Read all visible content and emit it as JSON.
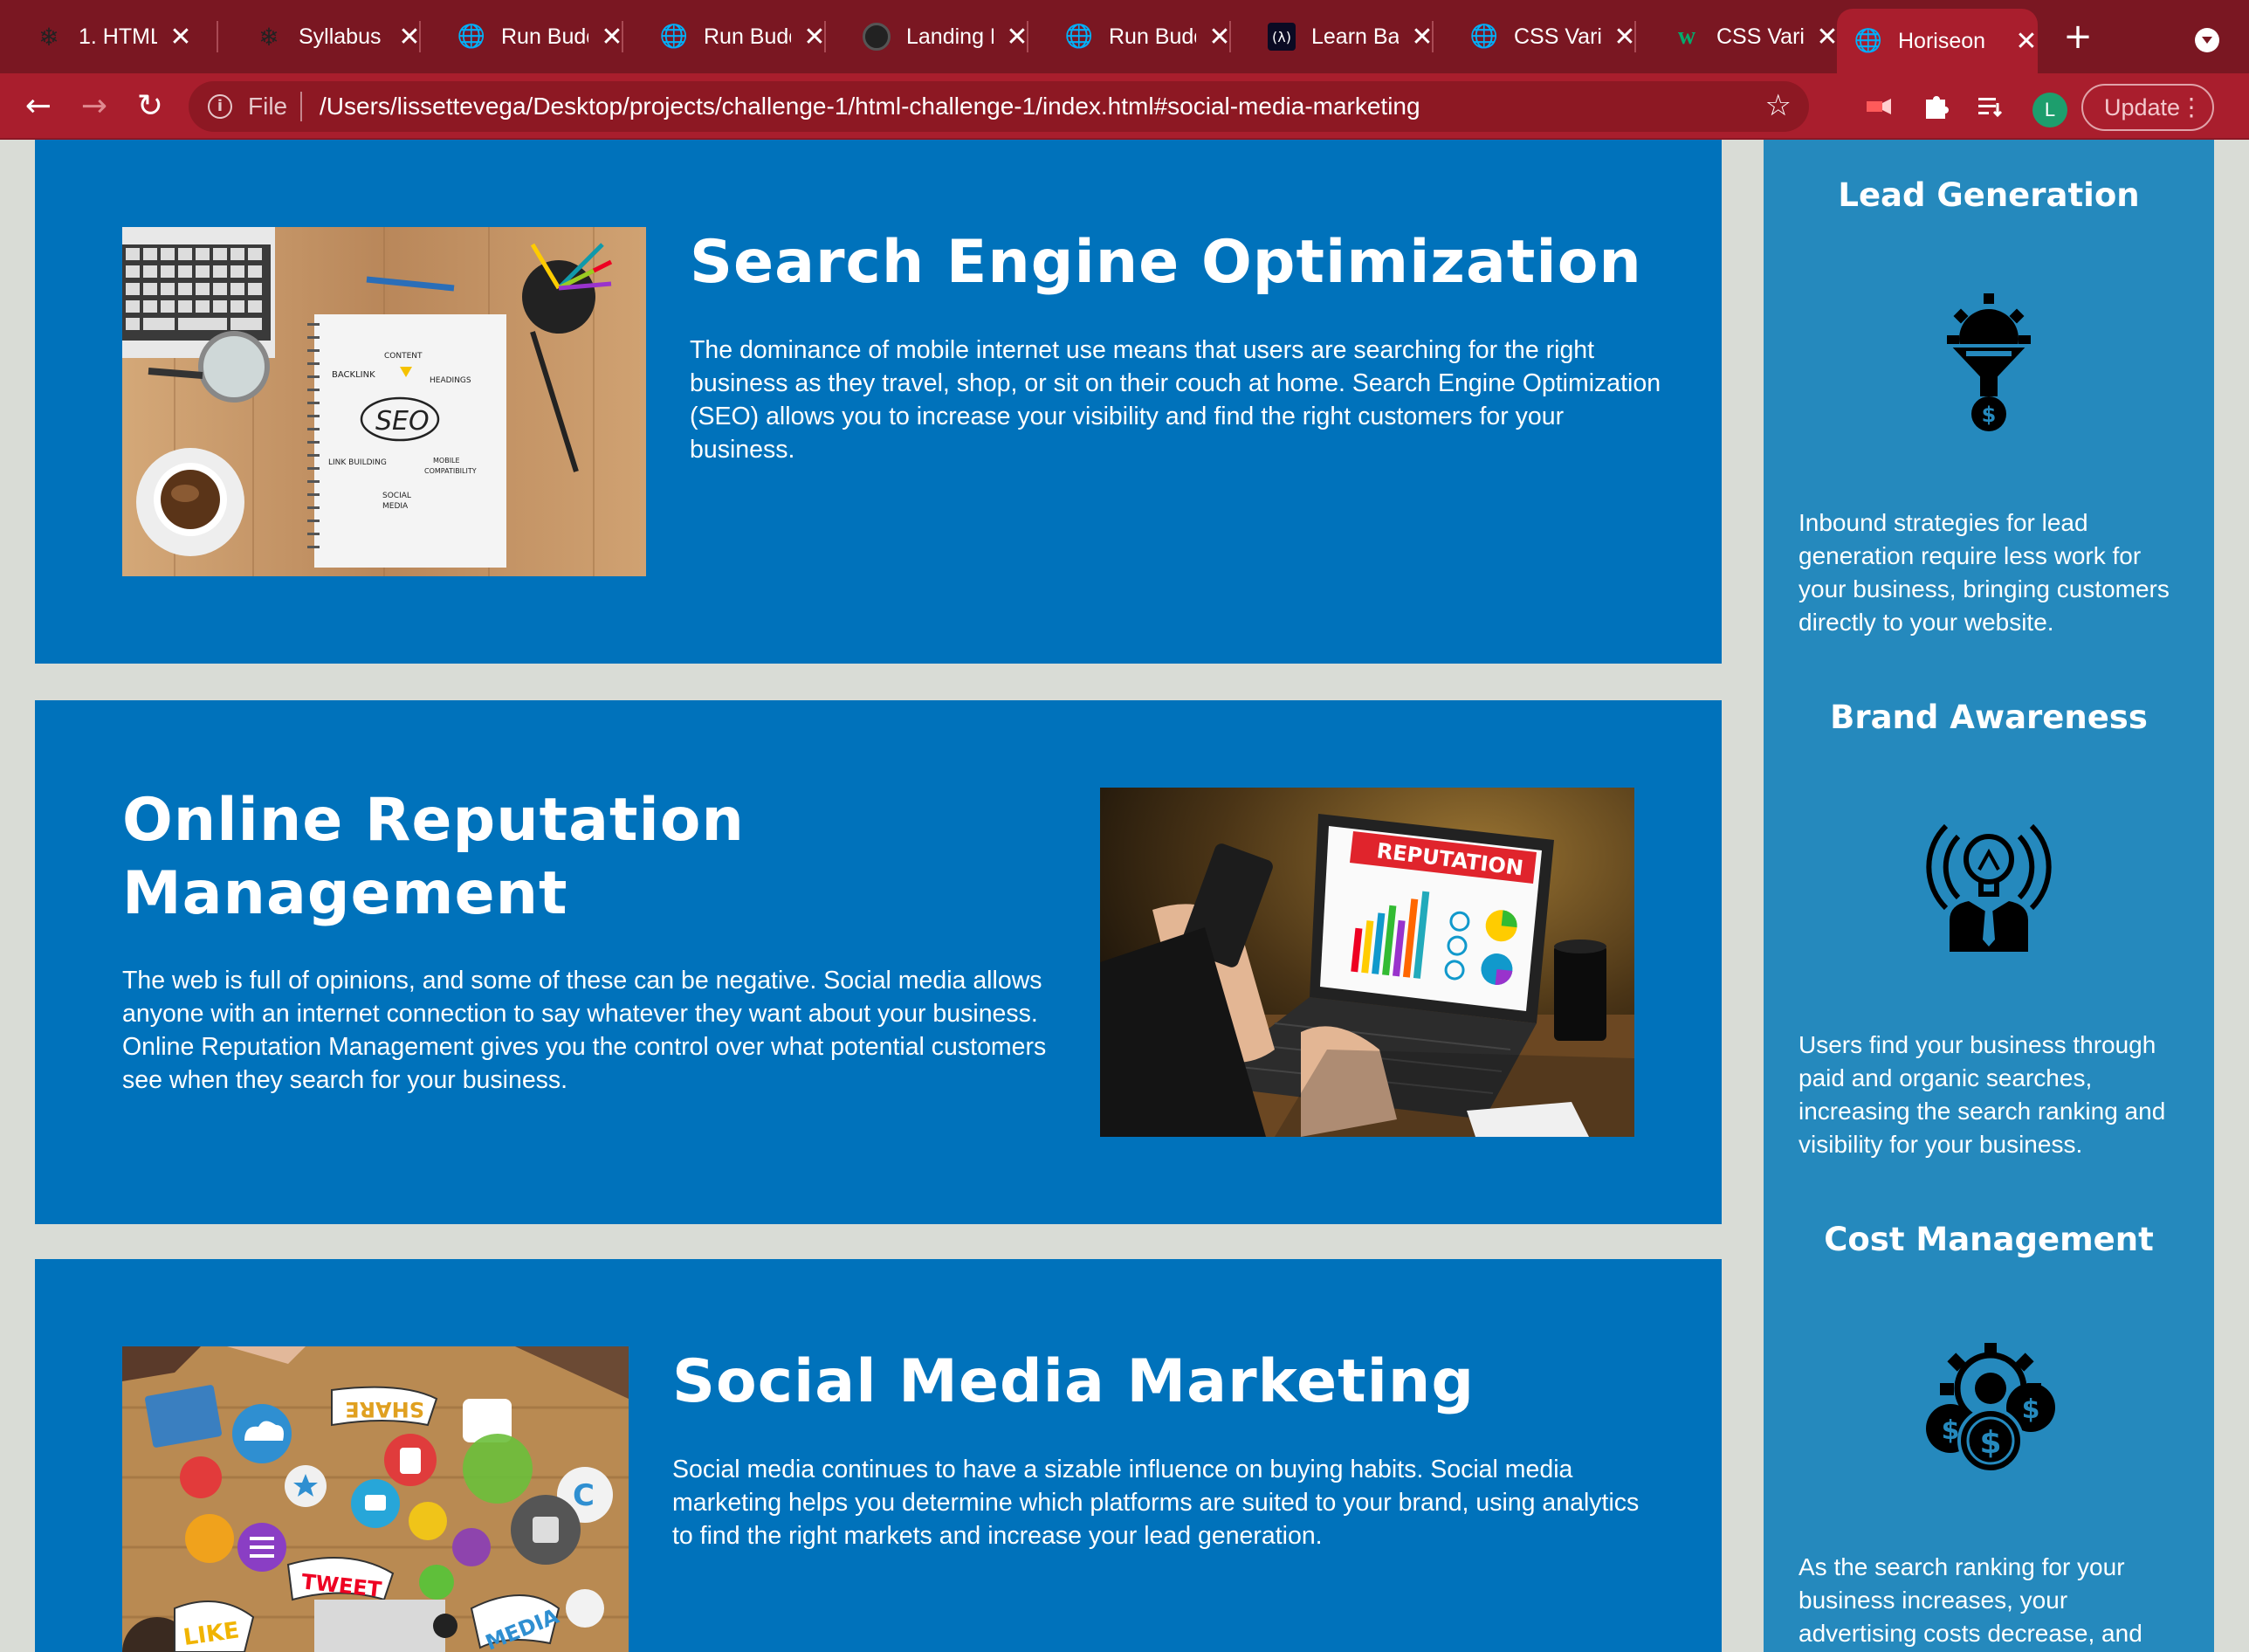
{
  "browser": {
    "tabs": [
      {
        "title": "1. HTML",
        "favicon": "ucf-pegasus-icon"
      },
      {
        "title": "Syllabus",
        "favicon": "ucf-pegasus-icon"
      },
      {
        "title": "Run Budd",
        "favicon": "globe-icon"
      },
      {
        "title": "Run Budd",
        "favicon": "globe-icon"
      },
      {
        "title": "Landing P",
        "favicon": "github-icon"
      },
      {
        "title": "Run Budd",
        "favicon": "globe-icon"
      },
      {
        "title": "Learn Ba",
        "favicon": "freecodecamp-icon"
      },
      {
        "title": "CSS Vari",
        "favicon": "globe-icon"
      },
      {
        "title": "CSS Vari",
        "favicon": "w3schools-icon"
      },
      {
        "title": "Horiseon",
        "favicon": "globe-icon",
        "active": true
      }
    ],
    "address": {
      "scheme": "File",
      "url": "/Users/lissettevega/Desktop/projects/challenge-1/html-challenge-1/index.html#social-media-marketing"
    },
    "avatar_letter": "L",
    "update_label": "Update",
    "colors": {
      "tabstrip": "#7a1722",
      "toolbar": "#a91e2d"
    }
  },
  "content": {
    "articles": [
      {
        "id": "search-engine-optimization",
        "title": "Search Engine Optimization",
        "body": "The dominance of mobile internet use means that users are searching for the right business as they travel, shop, or sit on their couch at home. Search Engine Optimization (SEO) allows you to increase your visibility and find the right customers for your business.",
        "image_words": {
          "content": "CONTENT",
          "backlink": "BACKLINK",
          "headings": "HEADINGS",
          "seo": "SEO",
          "link_building": "LINK BUILDING",
          "mobile": "MOBILE",
          "compatibility": "COMPATIBILITY",
          "social": "SOCIAL",
          "media": "MEDIA"
        }
      },
      {
        "id": "online-reputation-management",
        "title_line1": "Online Reputation",
        "title_line2": "Management",
        "body": "The web is full of opinions, and some of these can be negative. Social media allows anyone with an internet connection to say whatever they want about your business. Online Reputation Management gives you the control over what potential customers see when they search for your business.",
        "image_words": {
          "banner": "REPUTATION"
        }
      },
      {
        "id": "social-media-marketing",
        "title": "Social Media Marketing",
        "body": "Social media continues to have a sizable influence on buying habits. Social media marketing helps you determine which platforms are suited to your brand, using analytics to find the right markets and increase your lead generation.",
        "image_words": {
          "share": "SHARE",
          "tweet": "TWEET",
          "like": "LIKE",
          "media": "MEDIA"
        }
      }
    ],
    "benefits": [
      {
        "title": "Lead Generation",
        "icon": "funnel-gear-dollar-icon",
        "body": "Inbound strategies for lead generation require less work for your business, bringing customers directly to your website."
      },
      {
        "title": "Brand Awareness",
        "icon": "lightbulb-person-icon",
        "body": "Users find your business through paid and organic searches, increasing the search ranking and visibility for your business."
      },
      {
        "title": "Cost Management",
        "icon": "gear-coins-icon",
        "body": "As the search ranking for your business increases, your advertising costs decrease, and"
      }
    ],
    "colors": {
      "article_bg": "#0072bb",
      "aside_bg": "#2589bd",
      "page_bg": "#d9dcd6"
    }
  }
}
